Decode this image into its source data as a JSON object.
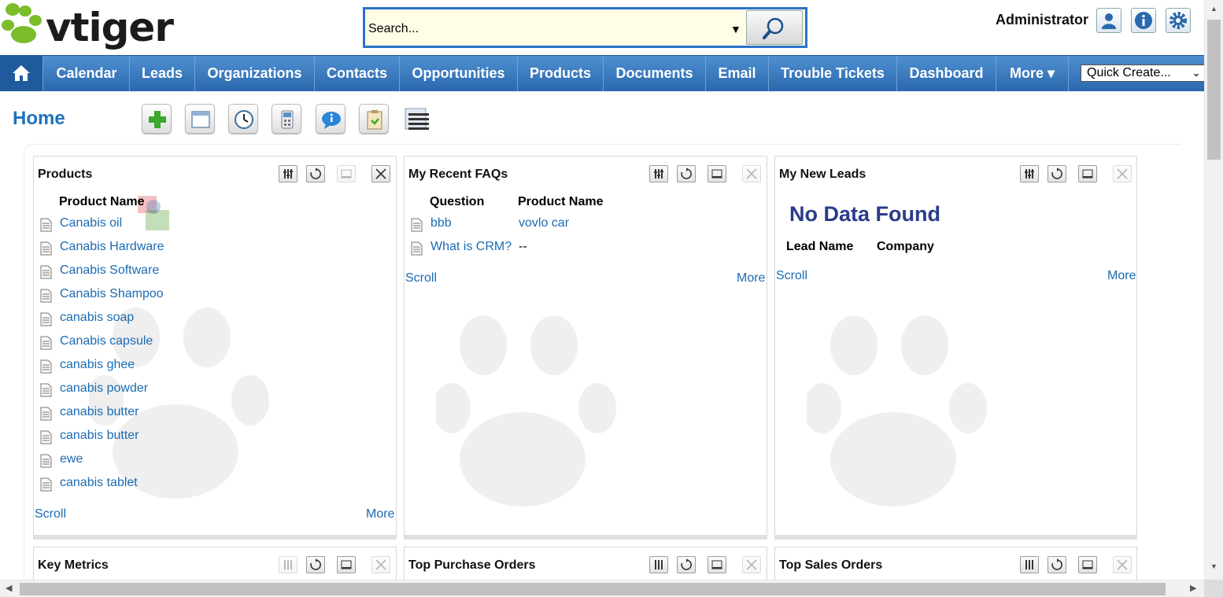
{
  "header": {
    "logo_text": "vtiger",
    "search_placeholder": "Search...",
    "user_name": "Administrator"
  },
  "nav": {
    "items": [
      "Calendar",
      "Leads",
      "Organizations",
      "Contacts",
      "Opportunities",
      "Products",
      "Documents",
      "Email",
      "Trouble Tickets",
      "Dashboard",
      "More"
    ],
    "more_arrow": "▾",
    "quick_create": "Quick Create..."
  },
  "page": {
    "title": "Home"
  },
  "widgets": {
    "products": {
      "title": "Products",
      "column": "Product Name",
      "items": [
        "Canabis oil",
        "Canabis Hardware",
        "Canabis Software",
        "Canabis Shampoo",
        "canabis soap",
        "Canabis capsule",
        "canabis ghee",
        "canabis powder",
        "canabis butter",
        "canabis butter",
        "ewe",
        "canabis tablet"
      ],
      "scroll": "Scroll",
      "more": "More"
    },
    "faqs": {
      "title": "My Recent FAQs",
      "columns": [
        "Question",
        "Product Name"
      ],
      "rows": [
        {
          "question": "bbb",
          "product": "vovlo car"
        },
        {
          "question": "What is CRM?",
          "product": "--"
        }
      ],
      "scroll": "Scroll",
      "more": "More"
    },
    "leads": {
      "title": "My New Leads",
      "no_data": "No Data Found",
      "columns": [
        "Lead Name",
        "Company"
      ],
      "scroll": "Scroll",
      "more": "More"
    },
    "key_metrics": {
      "title": "Key Metrics"
    },
    "purchase_orders": {
      "title": "Top Purchase Orders"
    },
    "sales_orders": {
      "title": "Top Sales Orders"
    }
  },
  "colors": {
    "nav_blue": "#2a68ad",
    "link_blue": "#1b6bb3",
    "title_blue": "#1e73be",
    "no_data_color": "#2a3b8a",
    "logo_green": "#7bbd2a"
  }
}
